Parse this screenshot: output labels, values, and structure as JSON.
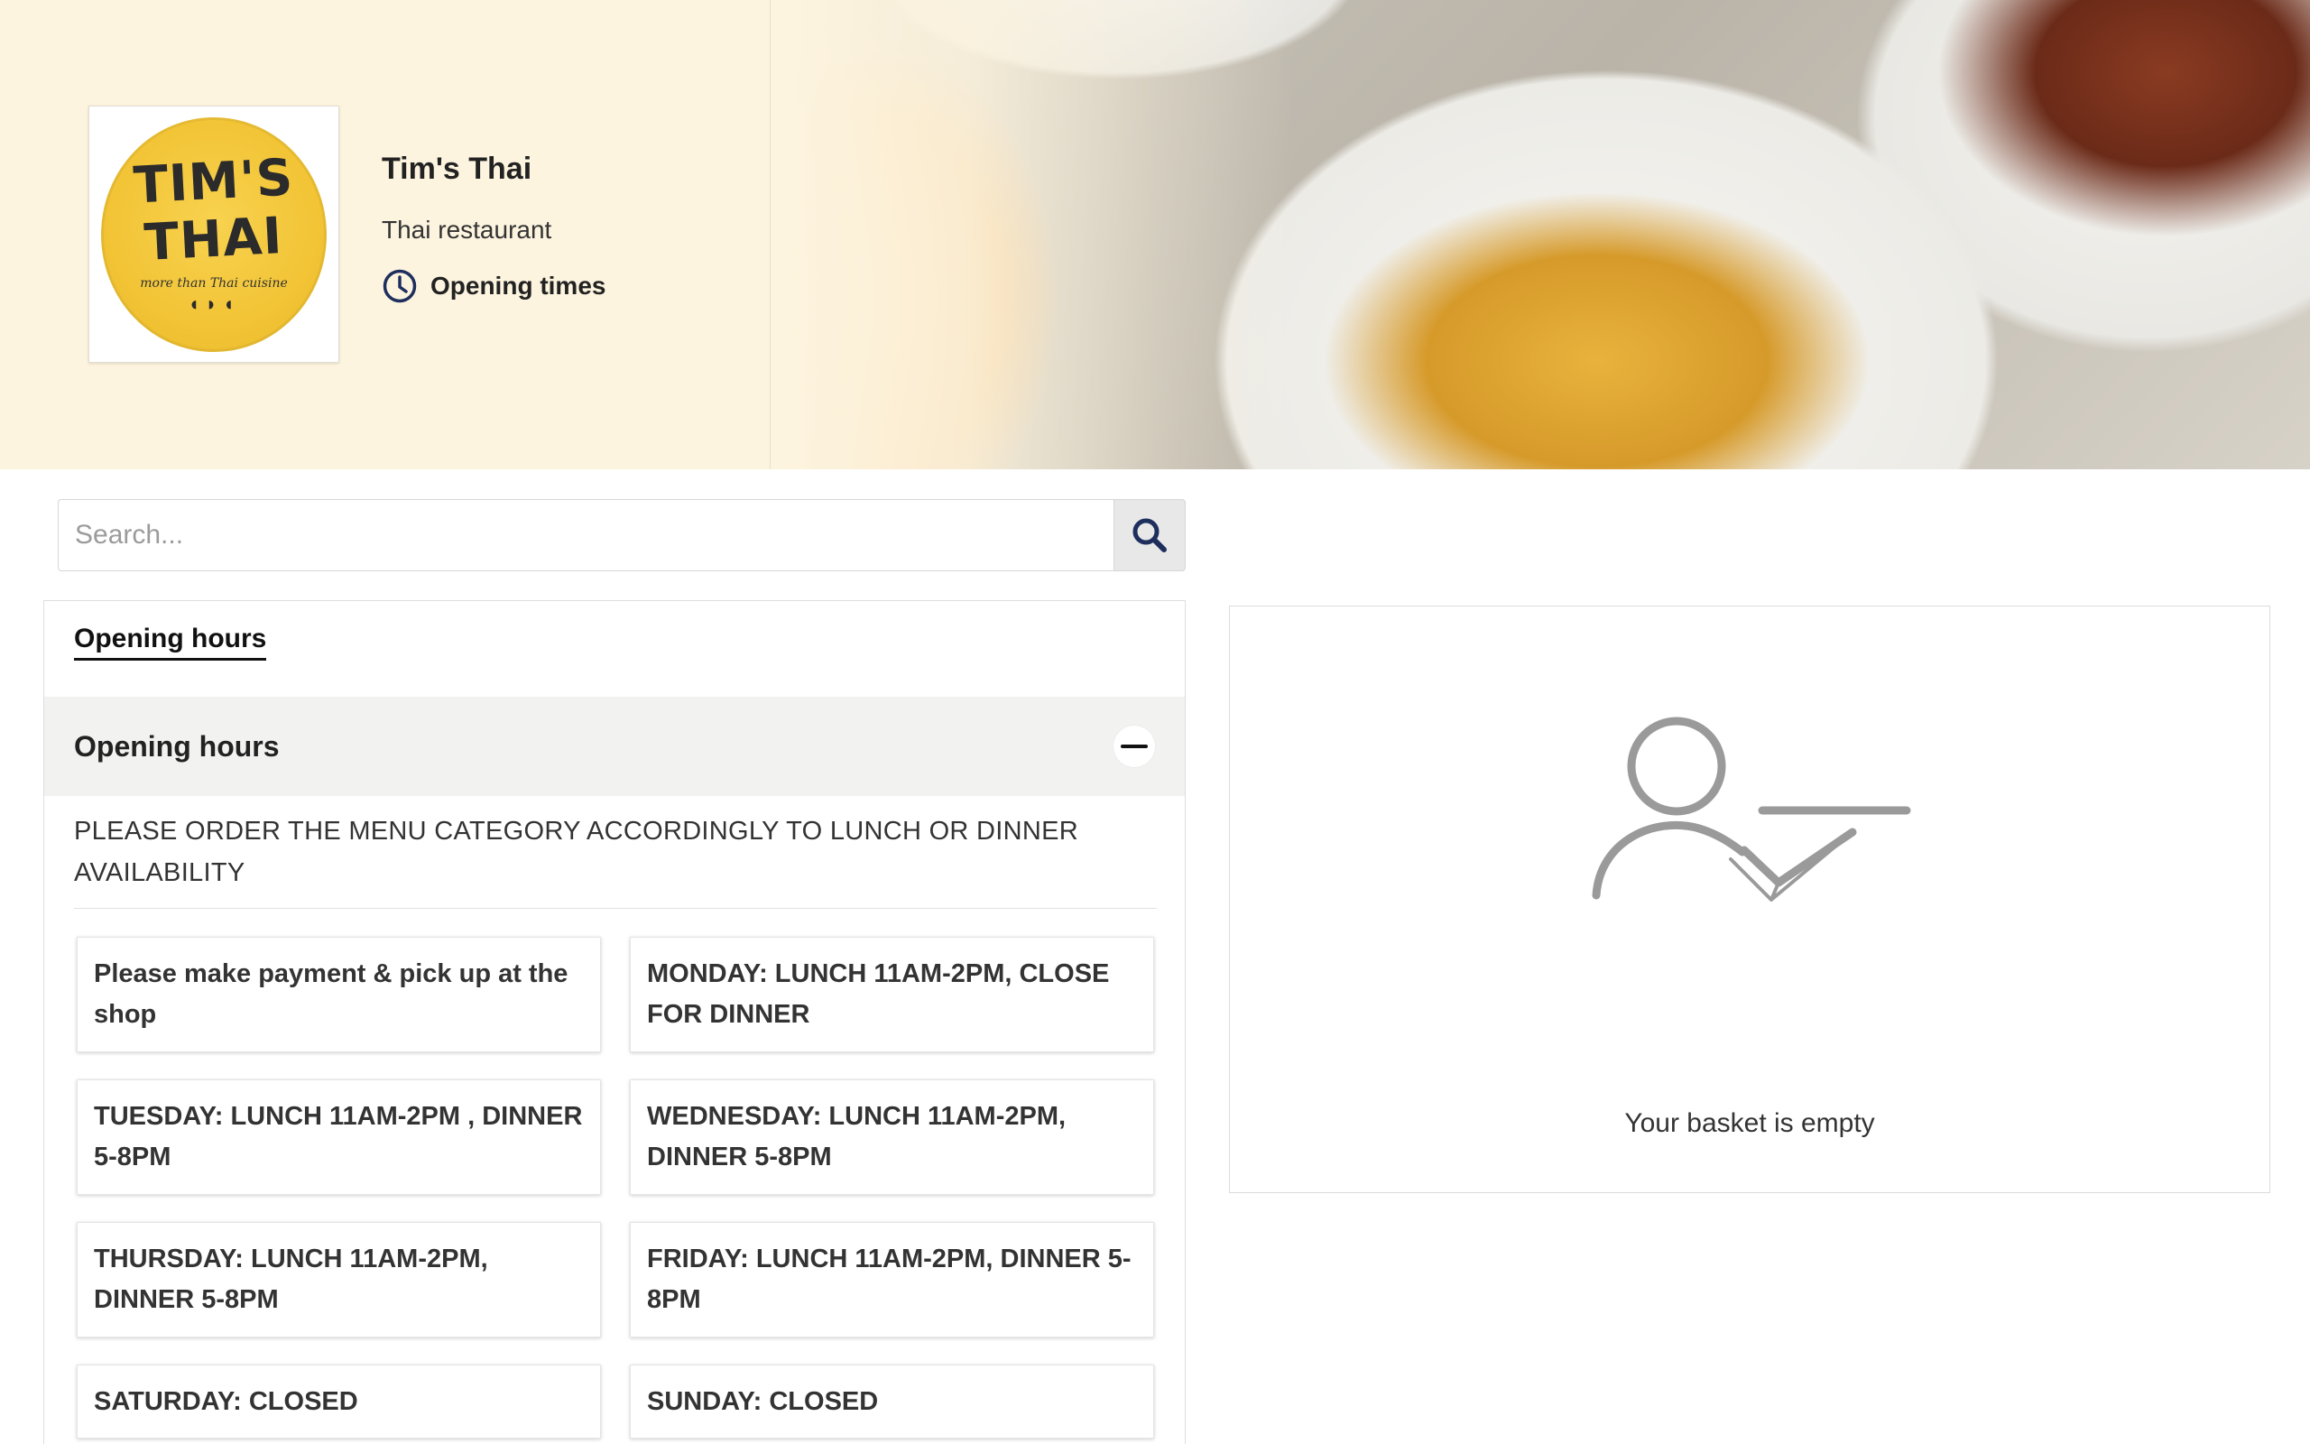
{
  "shop": {
    "logo_line1": "TIM'S",
    "logo_line2": "THAI",
    "logo_tagline": "more than Thai cuisine",
    "name": "Tim's Thai",
    "type": "Thai restaurant",
    "opening_times_label": "Opening times"
  },
  "search": {
    "placeholder": "Search..."
  },
  "tabs": {
    "opening_hours": "Opening hours"
  },
  "section": {
    "title": "Opening hours",
    "notice": "PLEASE ORDER THE MENU CATEGORY ACCORDINGLY TO LUNCH OR DINNER AVAILABILITY"
  },
  "hours": [
    "Please make payment & pick up at the shop",
    "MONDAY: LUNCH 11AM-2PM, CLOSE FOR DINNER",
    "TUESDAY: LUNCH 11AM-2PM , DINNER 5-8PM",
    "WEDNESDAY: LUNCH 11AM-2PM, DINNER 5-8PM",
    "THURSDAY: LUNCH 11AM-2PM, DINNER 5-8PM",
    "FRIDAY: LUNCH 11AM-2PM, DINNER 5-8PM",
    "SATURDAY: CLOSED",
    "SUNDAY: CLOSED"
  ],
  "basket": {
    "empty_text": "Your basket is empty"
  },
  "icons": {
    "clock": "clock-icon",
    "search": "search-icon",
    "collapse": "minus-icon",
    "basket": "user-check-icon"
  },
  "colors": {
    "hero_cream": "#fdf4df",
    "logo_yellow": "#f2c436",
    "icon_navy": "#1e2f5e",
    "section_bg": "#f2f2f1"
  }
}
